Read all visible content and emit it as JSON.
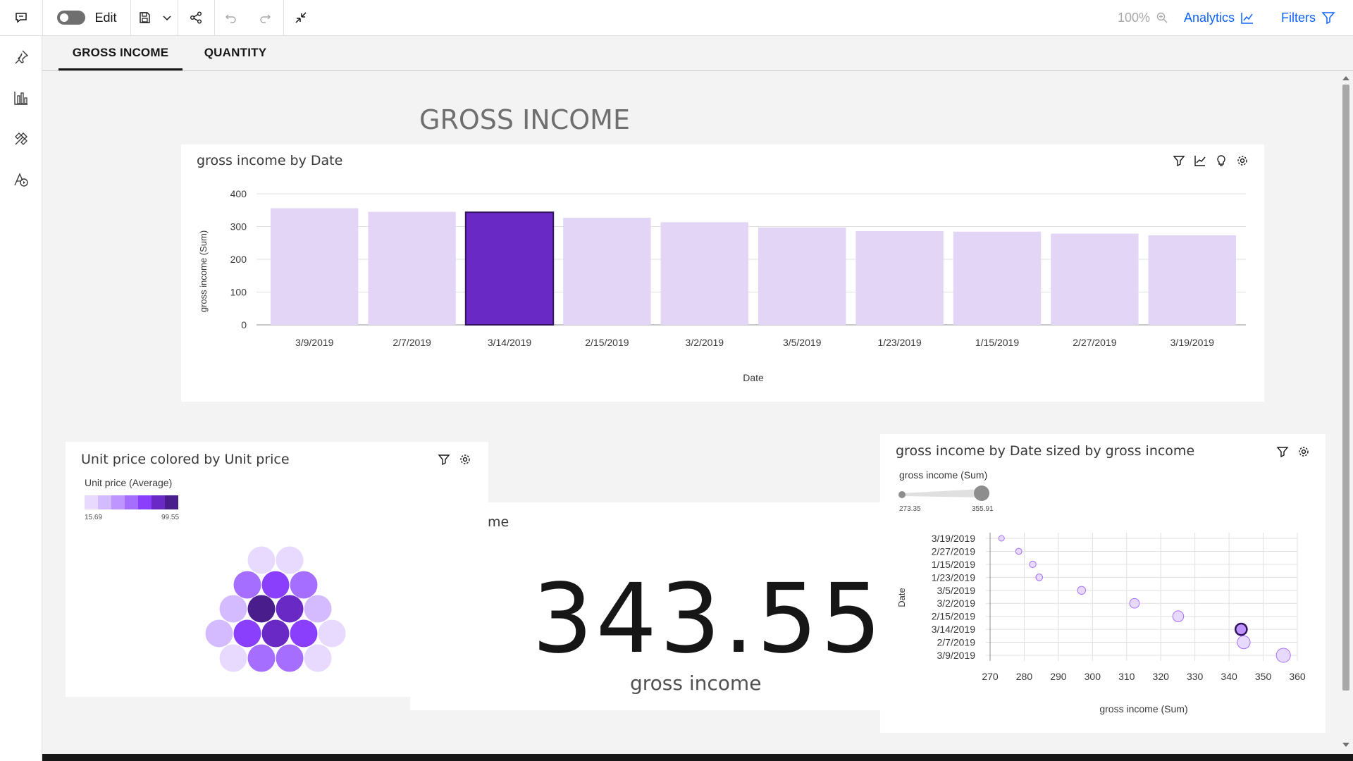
{
  "toolbar": {
    "edit_label": "Edit",
    "zoom": "100%",
    "analytics_label": "Analytics",
    "filters_label": "Filters"
  },
  "tabs": [
    {
      "label": "GROSS INCOME",
      "active": true
    },
    {
      "label": "QUANTITY",
      "active": false
    }
  ],
  "dashboard": {
    "title": "GROSS INCOME"
  },
  "bar_card": {
    "title": "gross income by Date",
    "ylabel": "gross income (Sum)",
    "xlabel": "Date",
    "yticks": [
      "0",
      "100",
      "200",
      "300",
      "400"
    ]
  },
  "packed_card": {
    "title": "Unit price colored by Unit price",
    "legend_title": "Unit price (Average)",
    "legend_min": "15.69",
    "legend_max": "99.55"
  },
  "kpi_card": {
    "title_fragment": "me",
    "value": "343.55",
    "label": "gross income"
  },
  "scatter_card": {
    "title": "gross income by Date sized by gross income",
    "size_legend_title": "gross income (Sum)",
    "size_min": "273.35",
    "size_max": "355.91",
    "xlabel": "gross income (Sum)",
    "ylabel": "Date",
    "xticks": [
      "270",
      "280",
      "290",
      "300",
      "310",
      "320",
      "330",
      "340",
      "350",
      "360"
    ]
  },
  "colors": {
    "bar_light": "#e3d5f5",
    "bar_selected": "#6929c4",
    "accent_blue": "#0f62fe"
  },
  "chart_data": [
    {
      "type": "bar",
      "title": "gross income by Date",
      "categories": [
        "3/9/2019",
        "2/7/2019",
        "3/14/2019",
        "2/15/2019",
        "3/2/2019",
        "3/5/2019",
        "1/23/2019",
        "1/15/2019",
        "2/27/2019",
        "3/19/2019"
      ],
      "values": [
        355.91,
        344.9,
        343.55,
        326.7,
        313.2,
        297.1,
        286.2,
        284.4,
        278.4,
        273.35
      ],
      "selected_index": 2,
      "xlabel": "Date",
      "ylabel": "gross income (Sum)",
      "ylim": [
        0,
        400
      ]
    },
    {
      "type": "scatter",
      "title": "gross income by Date sized by gross income",
      "categories": [
        "3/19/2019",
        "2/27/2019",
        "1/15/2019",
        "1/23/2019",
        "3/5/2019",
        "3/2/2019",
        "2/15/2019",
        "3/14/2019",
        "2/7/2019",
        "3/9/2019"
      ],
      "x": [
        273.35,
        278.4,
        282.5,
        284.4,
        296.8,
        312.3,
        325.1,
        343.55,
        344.3,
        355.91
      ],
      "selected_index": 7,
      "xlabel": "gross income (Sum)",
      "ylabel": "Date",
      "xlim": [
        270,
        360
      ]
    }
  ]
}
